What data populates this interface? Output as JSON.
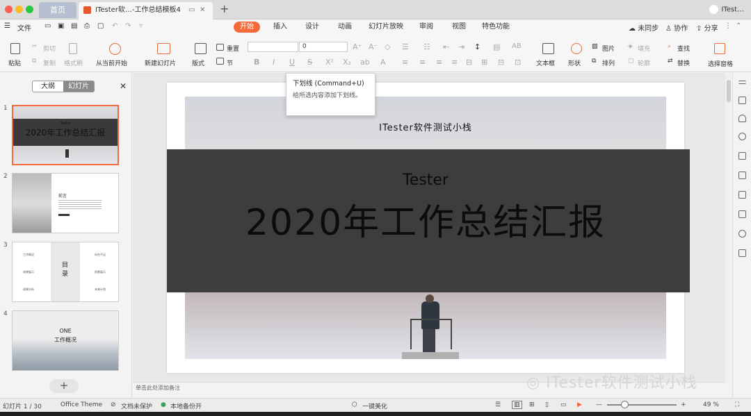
{
  "titlebar": {
    "tab_home": "首页",
    "tab_doc": "ITester软…-工作总结模板4",
    "tab_add": "+",
    "user_name": "ITest…"
  },
  "menubar": {
    "file": "文件",
    "tabs": [
      "开始",
      "插入",
      "设计",
      "动画",
      "幻灯片放映",
      "审阅",
      "视图",
      "特色功能"
    ],
    "sync": "未同步",
    "collab": "协作",
    "share": "分享"
  },
  "ribbon": {
    "paste": "粘贴",
    "cut": "剪切",
    "copy": "复制",
    "format_painter": "格式刷",
    "play_from_current": "从当前开始",
    "new_slide": "新建幻灯片",
    "layout": "版式",
    "reset": "重置",
    "section": "节",
    "font_size_value": "0",
    "textbox": "文本框",
    "shape": "形状",
    "picture": "图片",
    "arrange": "排列",
    "fill": "填充",
    "outline": "轮廓",
    "find": "查找",
    "replace": "替换",
    "select_pane": "选择窗格"
  },
  "tooltip": {
    "title": "下划线 (Command+U)",
    "desc": "给所选内容添加下划线。"
  },
  "sidebar": {
    "tab_outline": "大纲",
    "tab_slides": "幻灯片",
    "close": "✕",
    "add": "+",
    "slides": [
      {
        "num": "1",
        "title": "2020年工作总结汇报",
        "sub": "Tester"
      },
      {
        "num": "2",
        "title": "前言"
      },
      {
        "num": "3",
        "title": "目录",
        "items": [
          "工作概况",
          "成果展示",
          "成果分析",
          "存在不足",
          "前景展示",
          "未来计划"
        ]
      },
      {
        "num": "4",
        "title": "ONE",
        "sub": "工作概况"
      }
    ]
  },
  "slide": {
    "subtitle": "ITester软件测试小栈",
    "tester": "Tester",
    "title": "2020年工作总结汇报"
  },
  "notes_placeholder": "单击此处添加备注",
  "watermark": "ITester软件测试小栈",
  "status": {
    "slide_count": "幻灯片 1 / 30",
    "theme": "Office Theme",
    "protect": "文档未保护",
    "backup": "本地备份开",
    "beautify": "一键美化",
    "zoom": "49 %",
    "zoom_fraction": 0.49
  },
  "colors": {
    "accent": "#f46a3a",
    "band": "#3d3d3d"
  }
}
